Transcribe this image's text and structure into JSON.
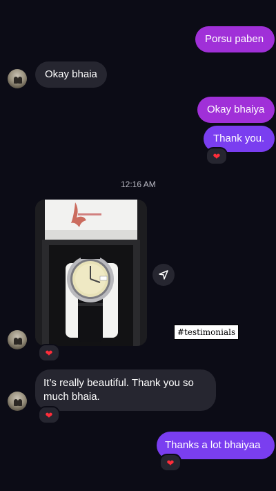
{
  "messages": {
    "m1": "Porsu paben",
    "m2": "Okay bhaia",
    "m3": "Okay bhaiya",
    "m4": "Thank you.",
    "m5_line1": "It’s really beautiful. Thank you so",
    "m5_line2": "much bhaia.",
    "m6": "Thanks a lot bhaiyaa"
  },
  "timestamp": "12:16 AM",
  "sticker_text": "#testimonials",
  "reaction": "❤",
  "colors": {
    "background": "#0c0c16",
    "outgoing_purple": "#a030d8",
    "outgoing_violet": "#7a3ef0",
    "incoming": "#262630",
    "heart": "#ff2d3a"
  },
  "icons": {
    "share": "send-icon",
    "reaction": "heart-icon",
    "avatar": "avatar"
  }
}
